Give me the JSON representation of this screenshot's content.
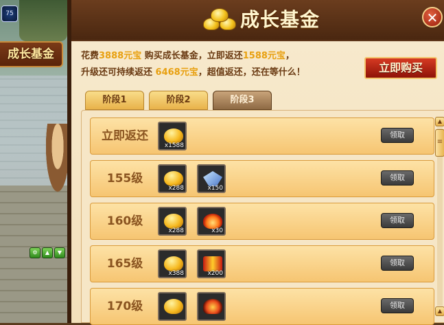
{
  "side": {
    "level_badge": "75",
    "tab_label": "成长基金",
    "mini_buttons": [
      "⚙",
      "▲",
      "▼"
    ]
  },
  "header": {
    "title": "成长基金",
    "close_icon": "close-icon",
    "close_glyph": "✕"
  },
  "description": {
    "line1": {
      "a": "花费",
      "b": "3888元宝",
      "c": " 购买成长基金，立即返还",
      "d": "1588元宝",
      "e": "，"
    },
    "line2": {
      "a": "升级还可持续返还 ",
      "b": "6468元宝",
      "c": "，超值返还，还在等什么！"
    }
  },
  "buy_button": "立即购买",
  "tabs": [
    {
      "label": "阶段1",
      "active": false
    },
    {
      "label": "阶段2",
      "active": false
    },
    {
      "label": "阶段3",
      "active": true
    }
  ],
  "rows": [
    {
      "label": "立即返还",
      "items": [
        {
          "icon": "gold-ingot-icon",
          "qty": "x1588"
        }
      ],
      "claim": "领取"
    },
    {
      "label": "155级",
      "items": [
        {
          "icon": "gold-ingot-icon",
          "qty": "x288"
        },
        {
          "icon": "crystal-icon",
          "qty": "x150"
        }
      ],
      "claim": "领取"
    },
    {
      "label": "160级",
      "items": [
        {
          "icon": "gold-ingot-icon",
          "qty": "x288"
        },
        {
          "icon": "fire-orb-icon",
          "qty": "x30"
        }
      ],
      "claim": "领取"
    },
    {
      "label": "165级",
      "items": [
        {
          "icon": "gold-ingot-icon",
          "qty": "x388"
        },
        {
          "icon": "rune-scroll-icon",
          "qty": "x200"
        }
      ],
      "claim": "领取"
    },
    {
      "label": "170级",
      "items": [
        {
          "icon": "gold-ingot-icon",
          "qty": ""
        },
        {
          "icon": "flame-icon",
          "qty": ""
        }
      ],
      "claim": "领取"
    }
  ],
  "scrollbar": {
    "up": "▲",
    "down": "▲"
  }
}
